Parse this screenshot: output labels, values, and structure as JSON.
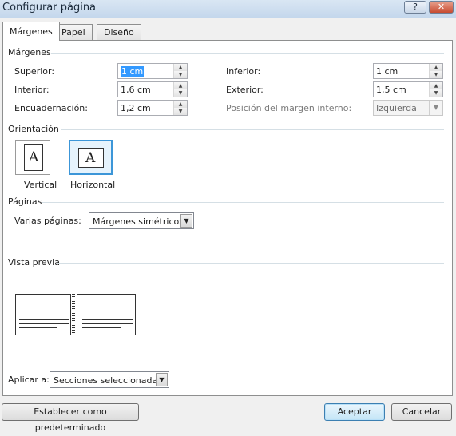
{
  "window": {
    "title": "Configurar página",
    "help_label": "?",
    "close_label": "✕"
  },
  "tabs": [
    {
      "label": "Márgenes",
      "active": true
    },
    {
      "label": "Papel",
      "active": false
    },
    {
      "label": "Diseño",
      "active": false
    }
  ],
  "margins": {
    "section_label": "Márgenes",
    "superior": {
      "label": "Superior:",
      "value": "1 cm"
    },
    "inferior": {
      "label": "Inferior:",
      "value": "1 cm"
    },
    "interior": {
      "label": "Interior:",
      "value": "1,6 cm"
    },
    "exterior": {
      "label": "Exterior:",
      "value": "1,5 cm"
    },
    "encuadernacion": {
      "label": "Encuadernación:",
      "value": "1,2 cm"
    },
    "posicion": {
      "label": "Posición del margen interno:",
      "value": "Izquierda"
    }
  },
  "orientation": {
    "section_label": "Orientación",
    "glyph": "A",
    "vertical": {
      "label": "Vertical"
    },
    "horizontal": {
      "label": "Horizontal",
      "selected": true
    }
  },
  "pages": {
    "section_label": "Páginas",
    "multiple_label": "Varias páginas:",
    "multiple_value": "Márgenes simétricos"
  },
  "preview": {
    "section_label": "Vista previa"
  },
  "apply": {
    "label": "Aplicar a:",
    "value": "Secciones seleccionadas"
  },
  "buttons": {
    "default_label": "Establecer como predeterminado",
    "accept_label": "Aceptar",
    "cancel_label": "Cancelar"
  },
  "colors": {
    "selection": "#3399ff",
    "title_bar": "#c4d7ec",
    "close": "#c74b30",
    "selected_orientation": "#3c96d8"
  }
}
